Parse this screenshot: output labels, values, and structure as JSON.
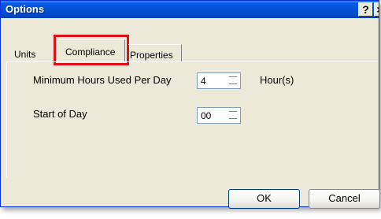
{
  "window": {
    "title": "Options",
    "help_label": "?",
    "close_label": "×"
  },
  "tabs": [
    {
      "label": "Units"
    },
    {
      "label": "Compliance",
      "highlighted": true
    },
    {
      "label": "Properties"
    }
  ],
  "fields": {
    "min_hours": {
      "label": "Minimum Hours Used Per Day",
      "value": "4",
      "unit": "Hour(s)"
    },
    "start_of_day": {
      "label": "Start of Day",
      "value": "00"
    }
  },
  "buttons": {
    "ok": "OK",
    "cancel": "Cancel"
  },
  "icons": {
    "spinner": "up-down-arrows-icon"
  },
  "colors": {
    "titlebar": "#0151d7",
    "dialog": "#ece9d8",
    "highlight": "#e00f18"
  }
}
